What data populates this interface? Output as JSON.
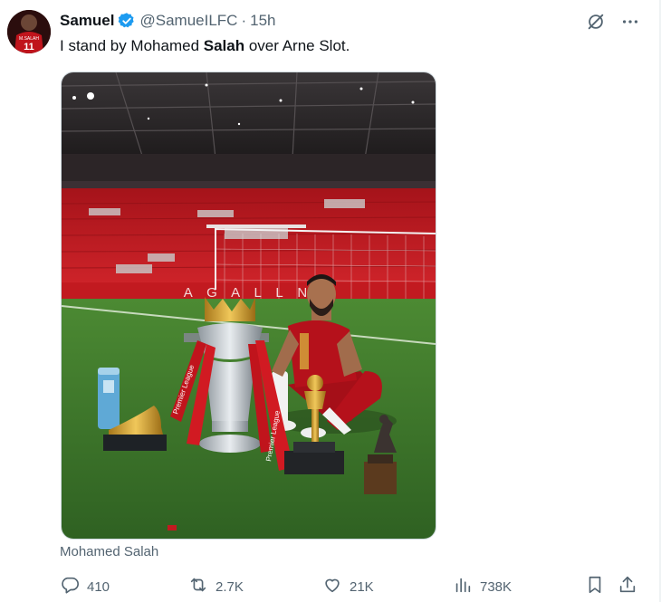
{
  "user": {
    "display_name": "Samuel",
    "handle": "@SamueILFC",
    "separator": "·",
    "time": "15h",
    "verified": true,
    "avatar_text": "M.SALAH",
    "avatar_number": "11"
  },
  "tweet": {
    "text_before": "I stand by Mohamed ",
    "text_bold": "Salah",
    "text_after": " over Arne Slot."
  },
  "media": {
    "caption": "Mohamed Salah",
    "board_text": "A G A L L N",
    "trophy_ribbon_text": "Premier League",
    "colors": {
      "stand_red": "#c8161d",
      "pitch_green": "#3f7a2b",
      "shirt_red": "#b5111b",
      "trophy_silver": "#c9ced3",
      "gold": "#c99a2e"
    }
  },
  "actions": {
    "replies": "410",
    "reposts": "2.7K",
    "likes": "21K",
    "views": "738K"
  },
  "icons": {
    "more": "more-icon",
    "grok": "grok-icon",
    "reply": "reply-icon",
    "repost": "repost-icon",
    "like": "heart-icon",
    "views": "views-icon",
    "bookmark": "bookmark-icon",
    "share": "share-icon"
  }
}
